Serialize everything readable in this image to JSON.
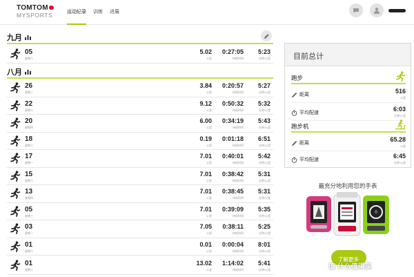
{
  "header": {
    "logo_main": "TOMTOM",
    "logo_sub": "MYSPORTS",
    "nav": [
      {
        "label": "运动纪录",
        "active": true
      },
      {
        "label": "训练",
        "active": false
      },
      {
        "label": "进展",
        "active": false
      }
    ]
  },
  "months": [
    {
      "label": "九月",
      "icon": "bar-chart-icon"
    },
    {
      "label": "八月",
      "icon": "bar-chart-icon"
    }
  ],
  "units": {
    "distance": "公里",
    "duration": "持续时间",
    "pace": "分钟/公里"
  },
  "activities": [
    {
      "day": "05",
      "weekday": "星期六",
      "distance": "5.02",
      "duration": "0:27:05",
      "pace": "5:23"
    },
    {
      "day": "26",
      "weekday": "星期三",
      "distance": "3.84",
      "duration": "0:20:57",
      "pace": "5:27"
    },
    {
      "day": "22",
      "weekday": "星期六",
      "distance": "9.12",
      "duration": "0:50:32",
      "pace": "5:32"
    },
    {
      "day": "20",
      "weekday": "星期四",
      "distance": "6.00",
      "duration": "0:34:19",
      "pace": "5:43"
    },
    {
      "day": "18",
      "weekday": "星期二",
      "distance": "0.19",
      "duration": "0:01:18",
      "pace": "6:51"
    },
    {
      "day": "17",
      "weekday": "星期一",
      "distance": "7.01",
      "duration": "0:40:01",
      "pace": "5:42"
    },
    {
      "day": "15",
      "weekday": "星期六",
      "distance": "7.01",
      "duration": "0:38:42",
      "pace": "5:31"
    },
    {
      "day": "13",
      "weekday": "星期四",
      "distance": "7.01",
      "duration": "0:38:45",
      "pace": "5:31"
    },
    {
      "day": "05",
      "weekday": "星期三",
      "distance": "7.01",
      "duration": "0:39:09",
      "pace": "5:35"
    },
    {
      "day": "03",
      "weekday": "星期一",
      "distance": "7.05",
      "duration": "0:38:11",
      "pace": "5:25"
    },
    {
      "day": "01",
      "weekday": "星期六",
      "distance": "0.01",
      "duration": "0:00:04",
      "pace": "8:01"
    },
    {
      "day": "01",
      "weekday": "星期六",
      "distance": "13.02",
      "duration": "1:14:02",
      "pace": "5:41"
    }
  ],
  "summary": {
    "title": "目前总计",
    "running": {
      "label": "跑步",
      "distance_label": "距离",
      "distance": "516",
      "distance_unit": "公里",
      "pace_label": "平均配速",
      "pace": "6:03",
      "pace_unit": "分钟/公里"
    },
    "treadmill": {
      "label": "跑步机",
      "distance_label": "距离",
      "distance": "65.28",
      "distance_unit": "公里",
      "pace_label": "平均配速",
      "pace": "6:45",
      "pace_unit": "分钟/公里"
    }
  },
  "promo": {
    "text": "最充分地利用您的手表",
    "button": "了解更多"
  },
  "watermark": "值 什么值得买",
  "colors": {
    "accent": "#a9c811",
    "accent_line": "#c9dd4a"
  }
}
